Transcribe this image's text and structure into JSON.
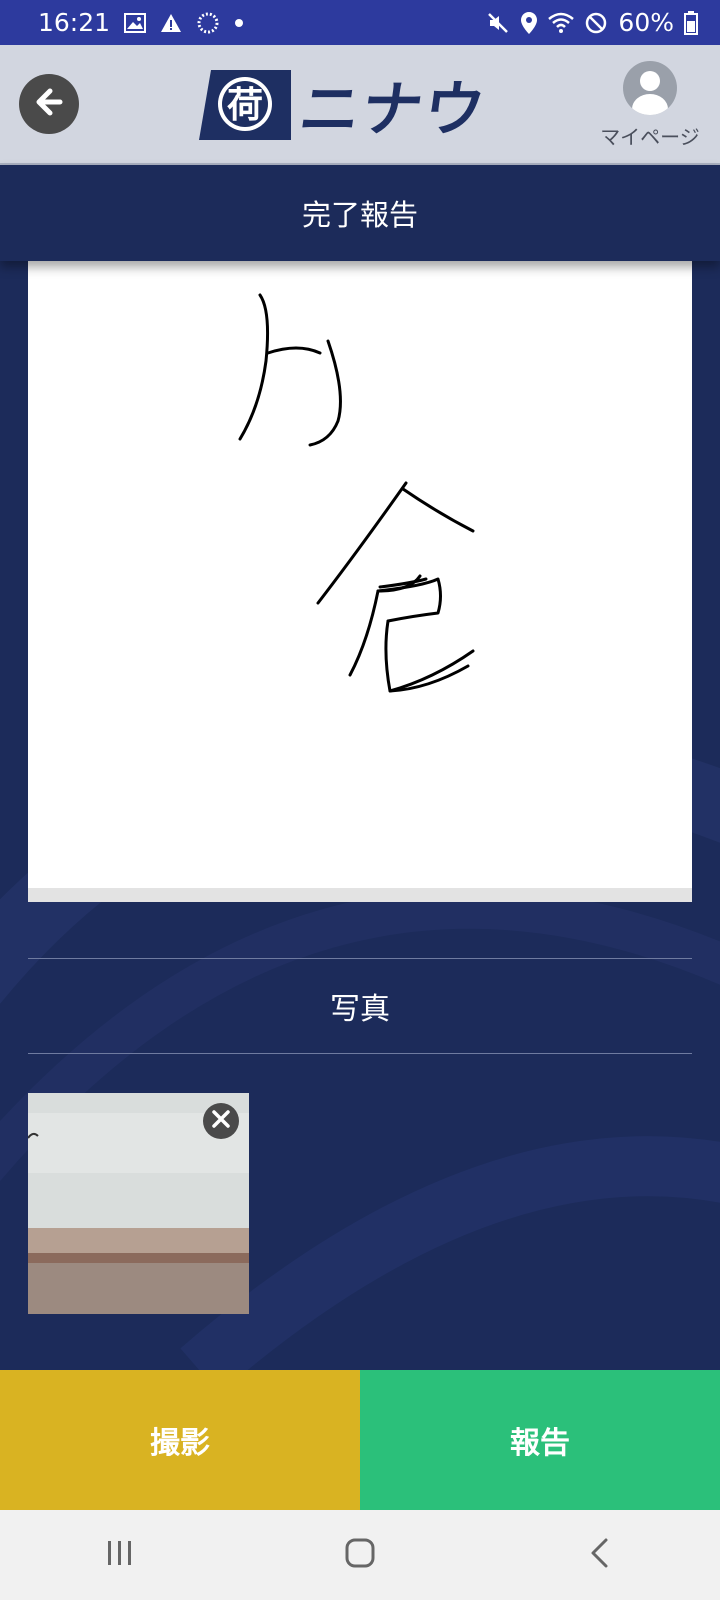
{
  "status_bar": {
    "time": "16:21",
    "battery": "60%",
    "icons_left": [
      "image-icon",
      "warning-icon",
      "loading-icon",
      "dot-icon"
    ],
    "icons_right": [
      "mute-icon",
      "location-icon",
      "wifi-icon",
      "block-icon",
      "battery-icon"
    ]
  },
  "header": {
    "logo_emblem_text": "荷",
    "logo_text": "ニナウ",
    "mypage_label": "マイページ"
  },
  "page": {
    "title": "完了報告"
  },
  "photo_section": {
    "title": "写真"
  },
  "buttons": {
    "shoot_label": "撮影",
    "report_label": "報告"
  },
  "colors": {
    "status_bar": "#2d3a9e",
    "header_bg": "#d2d6e0",
    "navy": "#1c2b5a",
    "shoot": "#d9b322",
    "report": "#2bc07a"
  }
}
